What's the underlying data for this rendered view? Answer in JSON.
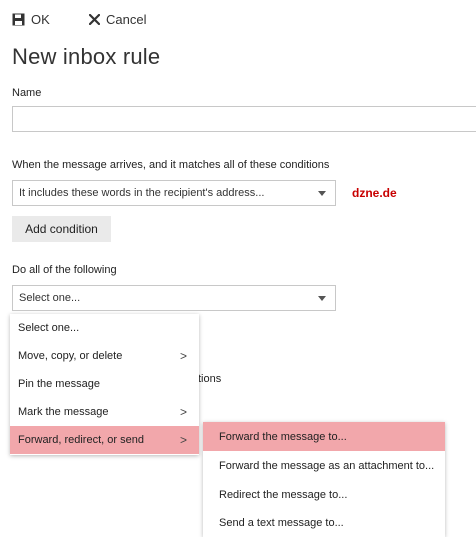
{
  "toolbar": {
    "ok_label": "OK",
    "cancel_label": "Cancel"
  },
  "page": {
    "title": "New inbox rule"
  },
  "name_field": {
    "label": "Name",
    "value": ""
  },
  "conditions": {
    "label": "When the message arrives, and it matches all of these conditions",
    "selected": "It includes these words in the recipient's address...",
    "matched_word": "dzne.de",
    "add_condition_label": "Add condition"
  },
  "actions": {
    "label": "Do all of the following",
    "selected": "Select one..."
  },
  "behind_text": "tions",
  "actions_menu": {
    "items": [
      {
        "label": "Select one...",
        "submenu": false
      },
      {
        "label": "Move, copy, or delete",
        "submenu": true
      },
      {
        "label": "Pin the message",
        "submenu": false
      },
      {
        "label": "Mark the message",
        "submenu": true
      },
      {
        "label": "Forward, redirect, or send",
        "submenu": true
      }
    ],
    "highlighted": "Forward, redirect, or send",
    "arrow_glyph": ">"
  },
  "forward_submenu": {
    "items": [
      {
        "label": "Forward the message to..."
      },
      {
        "label": "Forward the message as an attachment to..."
      },
      {
        "label": "Redirect the message to..."
      },
      {
        "label": "Send a text message to..."
      }
    ],
    "highlighted": "Forward the message to..."
  },
  "colors": {
    "highlight": "#f2a7ab",
    "matched_word": "#c80000"
  },
  "icons": {
    "ok": "save-icon",
    "cancel": "close-icon",
    "dropdown": "chevron-down-icon"
  }
}
